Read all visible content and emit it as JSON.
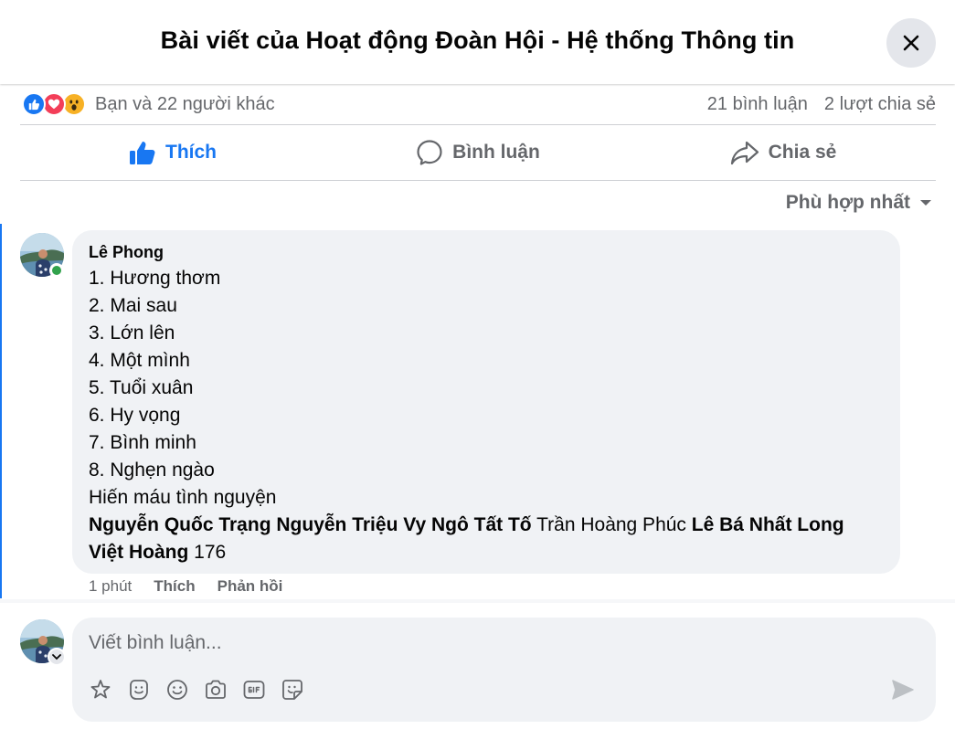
{
  "header": {
    "title": "Bài viết của Hoạt động Đoàn Hội - Hệ thống Thông tin"
  },
  "reactions": {
    "summary": "Bạn và 22 người khác",
    "comments_count": "21 bình luận",
    "shares_count": "2 lượt chia sẻ"
  },
  "actions": {
    "like": "Thích",
    "comment": "Bình luận",
    "share": "Chia sẻ"
  },
  "sort": {
    "label": "Phù hợp nhất"
  },
  "comment": {
    "author": "Lê Phong",
    "lines": [
      "1. Hương thơm",
      "2. Mai sau",
      "3. Lớn lên",
      "4. Một mình",
      "5. Tuổi xuân",
      "6. Hy vọng",
      "7. Bình minh",
      "8. Nghẹn ngào",
      "Hiến máu tình nguyện"
    ],
    "mentions": {
      "m1": "Nguyễn Quốc Trạng",
      "m2": "Nguyễn Triệu Vy",
      "m3": "Ngô Tất Tố",
      "plain1": "Trần Hoàng Phúc",
      "m4": "Lê Bá Nhất Long",
      "m5": "Việt Hoàng",
      "tail": "176"
    },
    "time": "1 phút",
    "like_label": "Thích",
    "reply_label": "Phản hồi"
  },
  "composer": {
    "placeholder": "Viết bình luận..."
  },
  "colors": {
    "brand_blue": "#1877f2",
    "secondary_text": "#65676b",
    "bubble_bg": "#f0f2f5",
    "online_green": "#31a24c"
  }
}
